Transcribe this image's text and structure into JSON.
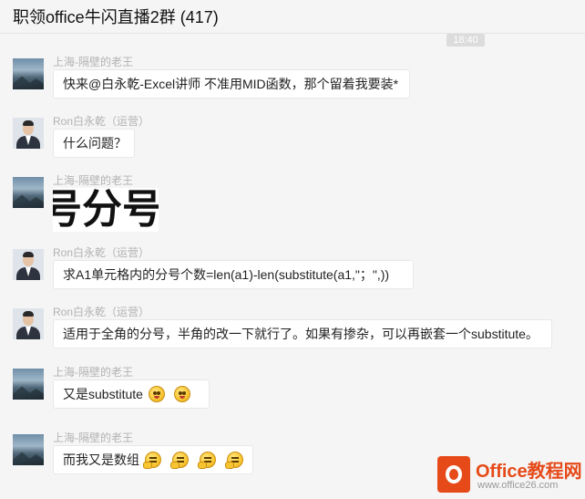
{
  "window": {
    "title": "职领office牛闪直播2群 (417)"
  },
  "timestamp": "18:40",
  "messages": [
    {
      "sender": "上海-隔壁的老王",
      "avatar": "landscape",
      "text": "快来@白永乾-Excel讲师 不准用MID函数，那个留着我要装*"
    },
    {
      "sender": "Ron白永乾（运营）",
      "avatar": "person",
      "text": "什么问题？"
    },
    {
      "sender": "上海-隔壁的老王",
      "avatar": "landscape",
      "image_text": "号分号"
    },
    {
      "sender": "Ron白永乾（运营）",
      "avatar": "person",
      "text": "求A1单元格内的分号个数=len(a1)-len(substitute(a1,\"；\",))"
    },
    {
      "sender": "Ron白永乾（运营）",
      "avatar": "person",
      "text": "适用于全角的分号，半角的改一下就行了。如果有掺杂，可以再嵌套一个substitute。"
    },
    {
      "sender": "上海-隔壁的老王",
      "avatar": "landscape",
      "text": "又是substitute",
      "emojis": [
        "flushed-face-icon",
        "flushed-face-icon"
      ]
    },
    {
      "sender": "上海-隔壁的老王",
      "avatar": "landscape",
      "text": "而我又是数组",
      "emojis": [
        "thinking-face-icon",
        "thinking-face-icon",
        "thinking-face-icon",
        "thinking-face-icon"
      ]
    }
  ],
  "watermark": {
    "brand": "Office教程网",
    "url": "www.office26.com"
  },
  "colors": {
    "background": "#f5f5f5",
    "bubble": "#ffffff",
    "sender_name": "#b2b2b2",
    "watermark_brand": "#e64a19"
  }
}
